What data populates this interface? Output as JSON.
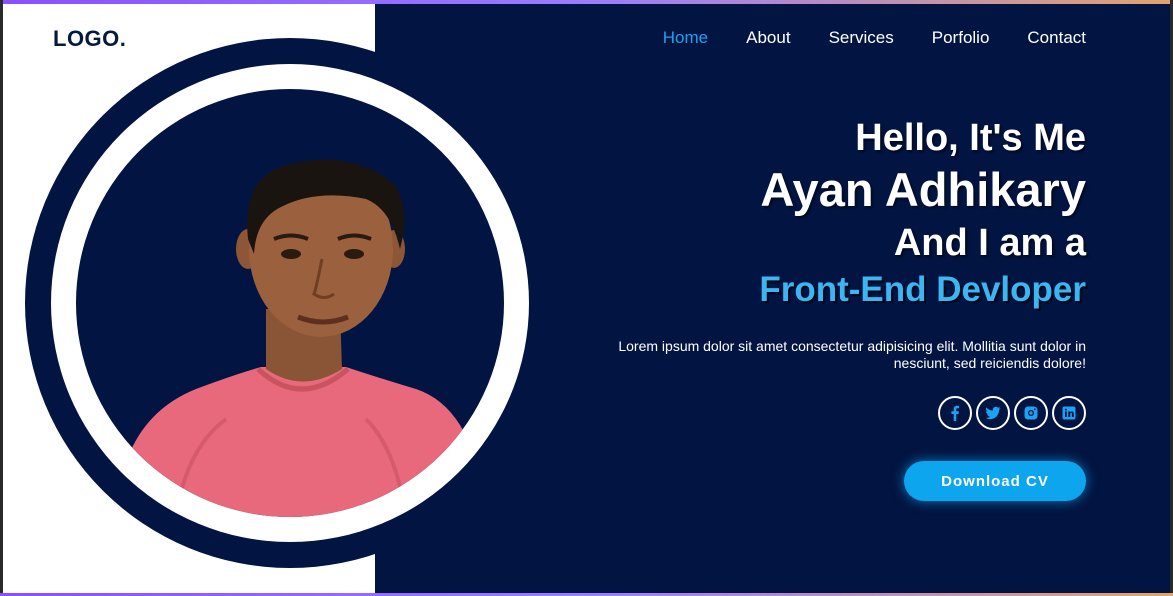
{
  "brand": {
    "logo": "LOGO."
  },
  "nav": {
    "items": [
      {
        "label": "Home",
        "active": true
      },
      {
        "label": "About",
        "active": false
      },
      {
        "label": "Services",
        "active": false
      },
      {
        "label": "Porfolio",
        "active": false
      },
      {
        "label": "Contact",
        "active": false
      }
    ]
  },
  "hero": {
    "greeting": "Hello, It's Me",
    "name": "Ayan Adhikary",
    "intro": "And I am a",
    "role": "Front-End Devloper",
    "description": "Lorem ipsum dolor sit amet consectetur adipisicing elit. Mollitia sunt dolor in nesciunt, sed reiciendis dolore!",
    "cta_label": "Download CV"
  },
  "socials": [
    {
      "icon": "facebook-icon"
    },
    {
      "icon": "twitter-icon"
    },
    {
      "icon": "instagram-icon"
    },
    {
      "icon": "linkedin-icon"
    }
  ],
  "colors": {
    "navy": "#021441",
    "accent": "#1da1f2",
    "button": "#0ea5ef",
    "role_text": "#3db5f0",
    "shirt": "#e8687c"
  }
}
